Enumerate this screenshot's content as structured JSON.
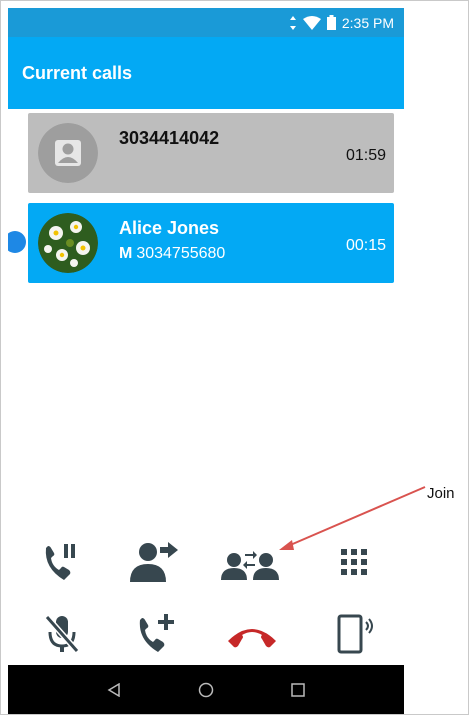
{
  "status_bar": {
    "time": "2:35 PM",
    "icons": [
      "vibrate-icon",
      "wifi-icon",
      "battery-icon"
    ]
  },
  "app_bar": {
    "title": "Current calls"
  },
  "calls": [
    {
      "name": "3034414042",
      "number_type": "",
      "number": "",
      "timer": "01:59",
      "state": "held"
    },
    {
      "name": "Alice Jones",
      "number_type": "M",
      "number": "3034755680",
      "timer": "00:15",
      "state": "active"
    }
  ],
  "controls": {
    "row1": [
      "hold-call-icon",
      "transfer-call-icon",
      "join-calls-icon",
      "dialpad-icon"
    ],
    "row2": [
      "mute-icon",
      "add-call-icon",
      "end-call-icon",
      "speaker-icon"
    ]
  },
  "annotation": {
    "label": "Join"
  },
  "colors": {
    "status_bar": "#1a9ad7",
    "app_bar": "#03a9f4",
    "held_card": "#bdbdbd",
    "end_call": "#c62828",
    "icon": "#37474f",
    "annotation_arrow": "#d9534f"
  }
}
